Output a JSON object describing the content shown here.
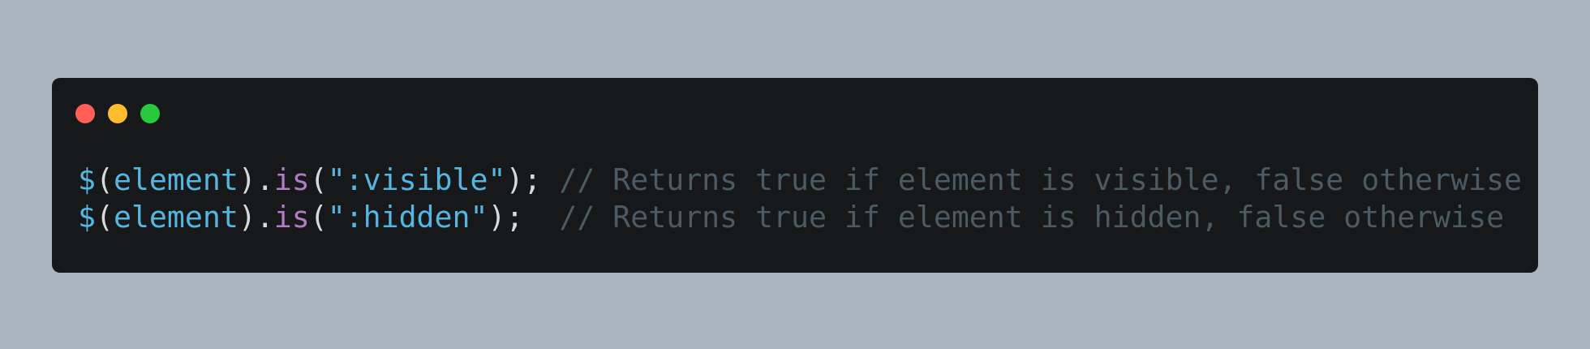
{
  "window": {
    "controls": [
      {
        "name": "close",
        "color": "#ff5f56"
      },
      {
        "name": "minimize",
        "color": "#ffbd2e"
      },
      {
        "name": "maximize",
        "color": "#27c93f"
      }
    ]
  },
  "code": {
    "lines": [
      {
        "dollar": "$",
        "open_paren": "(",
        "arg": "element",
        "close_paren_dot": ").",
        "method": "is",
        "call_open": "(",
        "string": "\":visible\"",
        "call_close": ");",
        "spacing": " ",
        "comment": "// Returns true if element is visible, false otherwise"
      },
      {
        "dollar": "$",
        "open_paren": "(",
        "arg": "element",
        "close_paren_dot": ").",
        "method": "is",
        "call_open": "(",
        "string": "\":hidden\"",
        "call_close": ");",
        "spacing": "  ",
        "comment": "// Returns true if element is hidden, false otherwise"
      }
    ]
  }
}
